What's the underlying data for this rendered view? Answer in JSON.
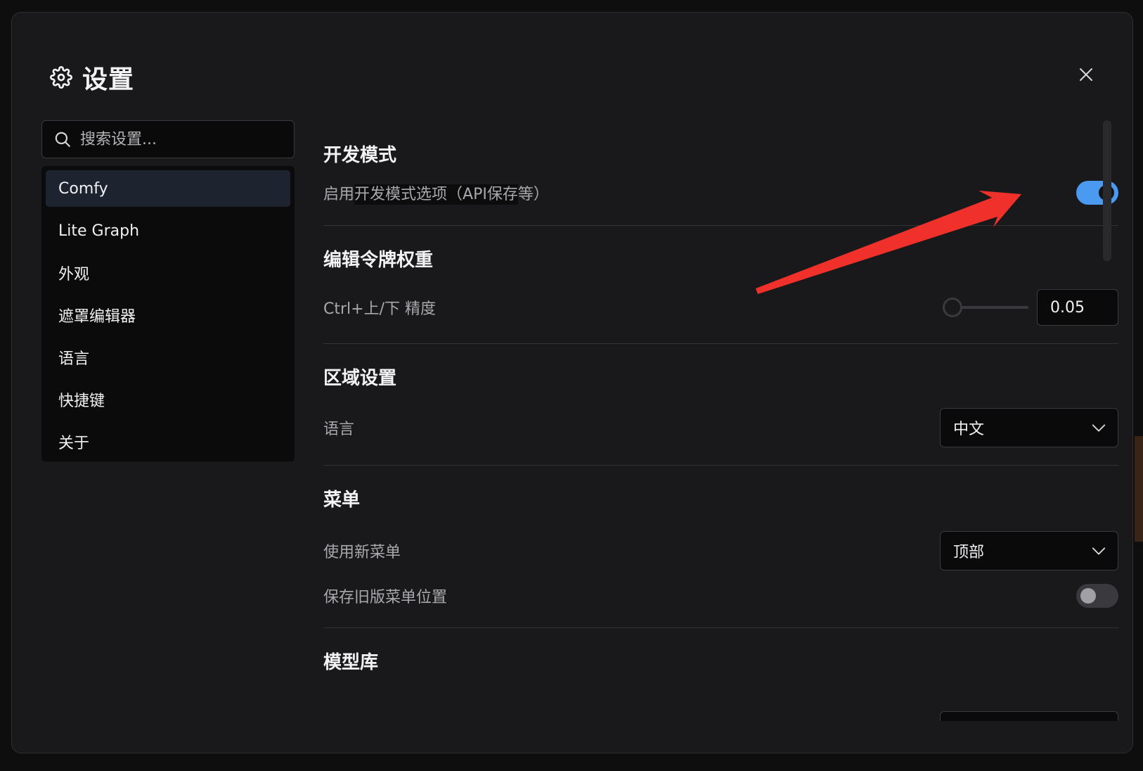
{
  "dialog": {
    "title": "设置",
    "search_placeholder": "搜索设置..."
  },
  "sidebar": {
    "items": [
      {
        "label": "Comfy",
        "active": true
      },
      {
        "label": "Lite Graph"
      },
      {
        "label": "外观"
      },
      {
        "label": "遮罩编辑器"
      },
      {
        "label": "语言"
      },
      {
        "label": "快捷键"
      },
      {
        "label": "关于"
      }
    ]
  },
  "sections": {
    "dev": {
      "title": "开发模式",
      "label_prefix": "启用",
      "label_highlight": "开发模式选项（API保存",
      "label_suffix": "等）",
      "enabled": true
    },
    "token": {
      "title": "编辑令牌权重",
      "label": "Ctrl+上/下 精度",
      "value": "0.05"
    },
    "locale": {
      "title": "区域设置",
      "label": "语言",
      "selected": "中文"
    },
    "menu": {
      "title": "菜单",
      "new_menu_label": "使用新菜单",
      "new_menu_selected": "顶部",
      "save_legacy_label": "保存旧版菜单位置",
      "save_legacy_enabled": false
    },
    "model": {
      "title": "模型库"
    }
  },
  "colors": {
    "accent": "#4b9af2",
    "annotation_arrow": "#f0302a"
  },
  "icons": {
    "settings": "gear-icon",
    "close": "close-icon",
    "search": "search-icon",
    "dropdown": "chevron-down-icon"
  }
}
